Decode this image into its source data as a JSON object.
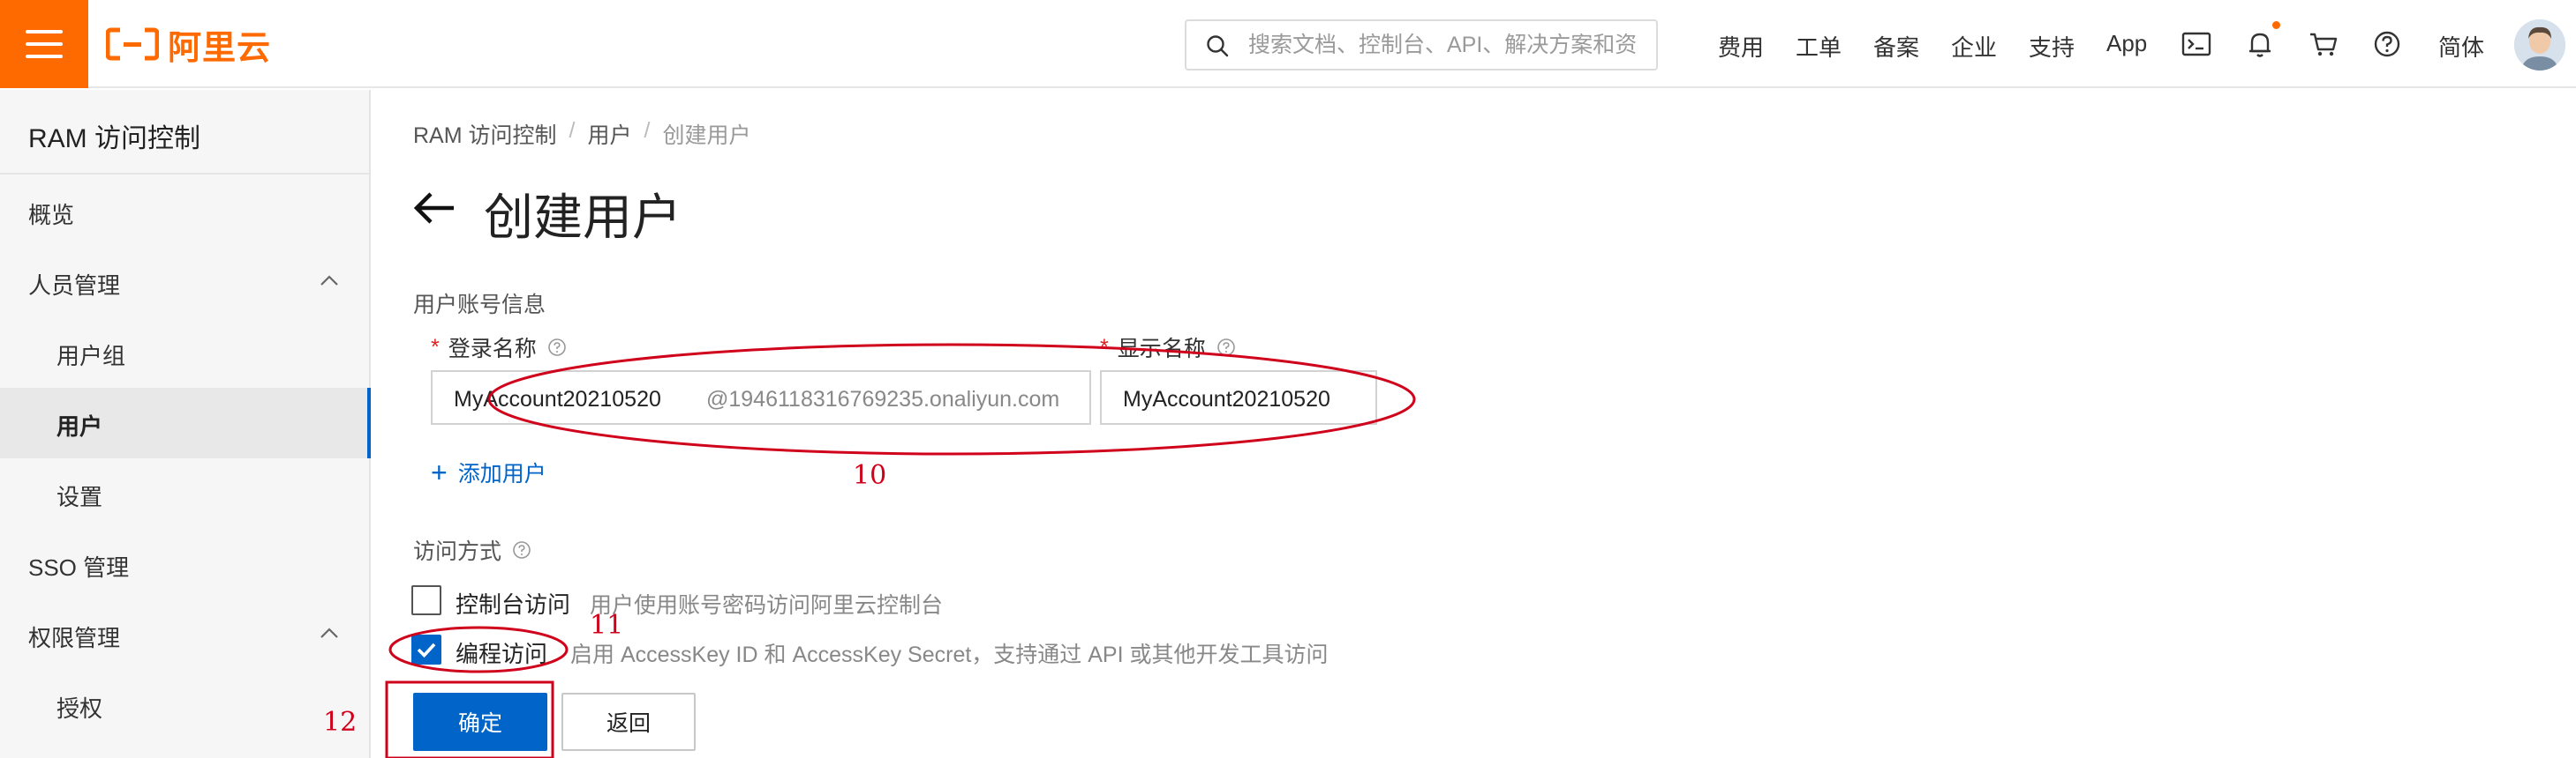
{
  "header": {
    "logo_text": "阿里云",
    "search_placeholder": "搜索文档、控制台、API、解决方案和资",
    "nav": [
      "费用",
      "工单",
      "备案",
      "企业",
      "支持",
      "App"
    ],
    "language": "简体",
    "brand_color": "#ff6a00"
  },
  "sidebar": {
    "title": "RAM 访问控制",
    "items": [
      {
        "label": "概览",
        "level": 1
      },
      {
        "label": "人员管理",
        "level": 1,
        "expanded": true
      },
      {
        "label": "用户组",
        "level": 2
      },
      {
        "label": "用户",
        "level": 2,
        "active": true
      },
      {
        "label": "设置",
        "level": 2
      },
      {
        "label": "SSO 管理",
        "level": 1
      },
      {
        "label": "权限管理",
        "level": 1,
        "expanded": true
      },
      {
        "label": "授权",
        "level": 2
      }
    ]
  },
  "breadcrumb": [
    "RAM 访问控制",
    "用户",
    "创建用户"
  ],
  "page": {
    "title": "创建用户"
  },
  "form": {
    "section_account": "用户账号信息",
    "login_name_label": "登录名称",
    "login_name_value": "MyAccount20210520",
    "login_name_suffix": "@1946118316769235.onaliyun.com",
    "display_name_label": "显示名称",
    "display_name_value": "MyAccount20210520",
    "add_user": "添加用户",
    "section_access": "访问方式",
    "access_console_label": "控制台访问",
    "access_console_desc": "用户使用账号密码访问阿里云控制台",
    "access_console_checked": false,
    "access_api_label": "编程访问",
    "access_api_desc": "启用 AccessKey ID 和 AccessKey Secret，支持通过 API 或其他开发工具访问",
    "access_api_checked": true,
    "confirm_button": "确定",
    "back_button": "返回"
  },
  "annotations": {
    "step_10": "10",
    "step_11": "11",
    "step_12": "12",
    "color": "#d0021b"
  }
}
